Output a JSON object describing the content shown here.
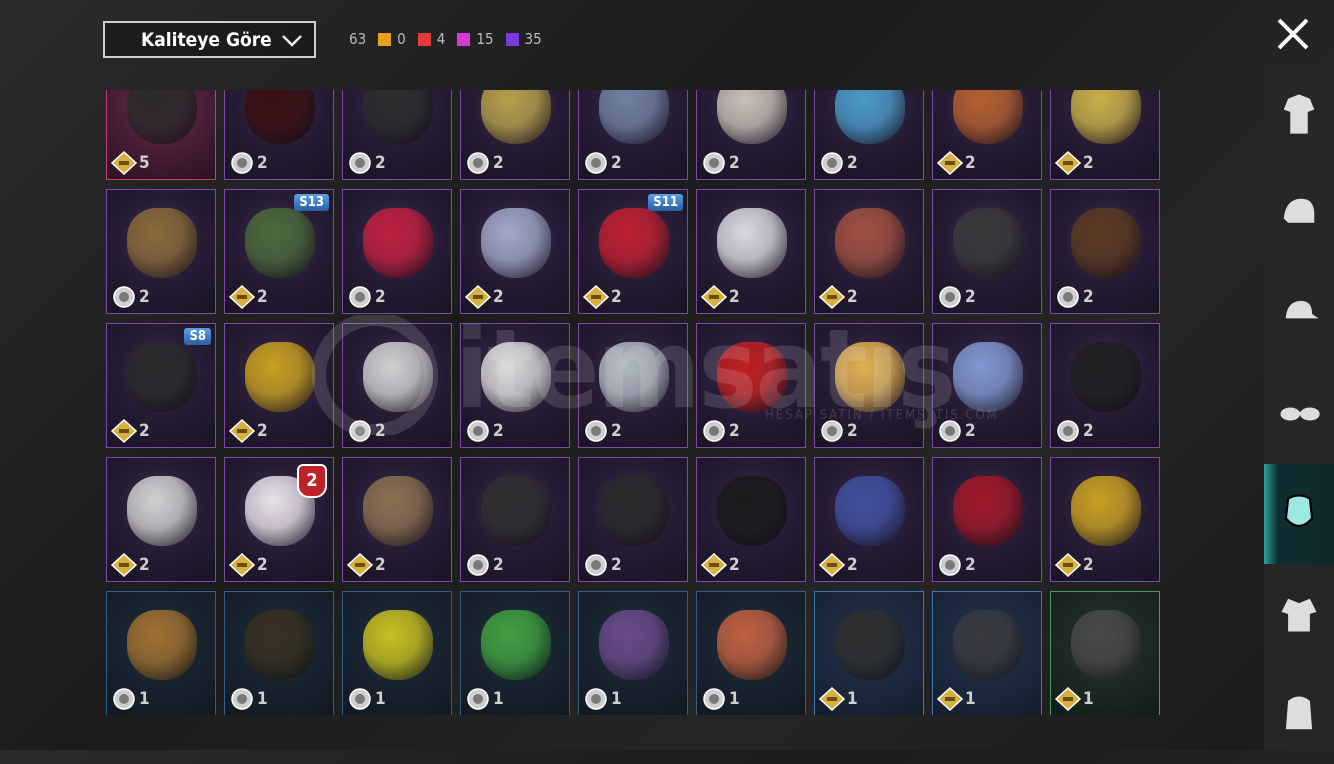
{
  "topbar": {
    "sort_label": "Kaliteye Göre",
    "total": "63",
    "counts": [
      {
        "color": "#e6a21e",
        "value": "0"
      },
      {
        "color": "#e23b3b",
        "value": "4"
      },
      {
        "color": "#d63ad6",
        "value": "15"
      },
      {
        "color": "#7a3ae0",
        "value": "35"
      }
    ]
  },
  "rows": [
    [
      {
        "tier": "pink",
        "art": "#2a2a2a",
        "qty": "5",
        "rank": true
      },
      {
        "tier": "purple",
        "art": "#3a1010",
        "qty": "2"
      },
      {
        "tier": "purple",
        "art": "#2c2c2c",
        "qty": "2"
      },
      {
        "tier": "purple",
        "art": "#b6a04a",
        "qty": "2"
      },
      {
        "tier": "purple",
        "art": "#7080a0",
        "qty": "2"
      },
      {
        "tier": "purple",
        "art": "#c8c0b6",
        "qty": "2"
      },
      {
        "tier": "purple",
        "art": "#4a9ac8",
        "qty": "2"
      },
      {
        "tier": "purple",
        "art": "#b56030",
        "qty": "2",
        "rank": true
      },
      {
        "tier": "purple",
        "art": "#c8b048",
        "qty": "2",
        "rank": true
      }
    ],
    [
      {
        "tier": "purple",
        "art": "#8a6a3a",
        "qty": "2"
      },
      {
        "tier": "purple",
        "art": "#4a6a3a",
        "qty": "2",
        "badge": "S13",
        "rank": true
      },
      {
        "tier": "purple",
        "art": "#c02040",
        "qty": "2"
      },
      {
        "tier": "purple",
        "art": "#a0a8c8",
        "qty": "2",
        "rank": true
      },
      {
        "tier": "purple",
        "art": "#c02030",
        "qty": "2",
        "badge": "S11",
        "rank": true
      },
      {
        "tier": "purple",
        "art": "#d8d8e0",
        "qty": "2",
        "rank": true
      },
      {
        "tier": "purple",
        "art": "#a05040",
        "qty": "2",
        "rank": true
      },
      {
        "tier": "purple",
        "art": "#3a3a3a",
        "qty": "2"
      },
      {
        "tier": "purple",
        "art": "#5a3a20",
        "qty": "2"
      }
    ],
    [
      {
        "tier": "purple",
        "art": "#2a2a2a",
        "qty": "2",
        "badge": "S8",
        "rank": true
      },
      {
        "tier": "purple",
        "art": "#c8a020",
        "qty": "2",
        "rank": true
      },
      {
        "tier": "purple",
        "art": "#d0d0d0",
        "qty": "2"
      },
      {
        "tier": "purple",
        "art": "#d8d8d8",
        "qty": "2"
      },
      {
        "tier": "purple",
        "art": "#b0b8c0",
        "qty": "2"
      },
      {
        "tier": "purple",
        "art": "#c02020",
        "qty": "2"
      },
      {
        "tier": "purple",
        "art": "#e0b050",
        "qty": "2"
      },
      {
        "tier": "purple",
        "art": "#8098d0",
        "qty": "2"
      },
      {
        "tier": "purple",
        "art": "#202020",
        "qty": "2"
      }
    ],
    [
      {
        "tier": "purple",
        "art": "#d0d0d0",
        "qty": "2",
        "rank": true
      },
      {
        "tier": "purple",
        "art": "#e8e0e8",
        "qty": "2",
        "count": "2",
        "rank": true
      },
      {
        "tier": "purple",
        "art": "#8a7050",
        "qty": "2",
        "rank": true
      },
      {
        "tier": "purple",
        "art": "#303030",
        "qty": "2"
      },
      {
        "tier": "purple",
        "art": "#2a2a2a",
        "qty": "2"
      },
      {
        "tier": "purple",
        "art": "#1a1a1a",
        "qty": "2",
        "rank": true
      },
      {
        "tier": "purple",
        "art": "#4050a0",
        "qty": "2",
        "rank": true
      },
      {
        "tier": "purple",
        "art": "#a01828",
        "qty": "2"
      },
      {
        "tier": "purple",
        "art": "#c8a020",
        "qty": "2",
        "rank": true
      }
    ],
    [
      {
        "tier": "blue",
        "art": "#a07030",
        "qty": "1"
      },
      {
        "tier": "blue",
        "art": "#3a3020",
        "qty": "1"
      },
      {
        "tier": "blue",
        "art": "#c8c020",
        "qty": "1"
      },
      {
        "tier": "blue",
        "art": "#40a040",
        "qty": "1"
      },
      {
        "tier": "blue",
        "art": "#6a4a8a",
        "qty": "1"
      },
      {
        "tier": "blue",
        "art": "#c06040",
        "qty": "1"
      },
      {
        "tier": "blue2",
        "art": "#303030",
        "qty": "1",
        "rank": true
      },
      {
        "tier": "blue2",
        "art": "#3a3a40",
        "qty": "1",
        "rank": true
      },
      {
        "tier": "green",
        "art": "#4a4a4a",
        "qty": "1",
        "rank": true
      }
    ]
  ],
  "sidebar": [
    {
      "name": "outfit-icon",
      "active": false
    },
    {
      "name": "helmet-icon",
      "active": false
    },
    {
      "name": "cap-icon",
      "active": false
    },
    {
      "name": "glasses-icon",
      "active": false
    },
    {
      "name": "mask-icon",
      "active": true
    },
    {
      "name": "jacket-icon",
      "active": false
    },
    {
      "name": "backpack-icon",
      "active": false
    }
  ],
  "watermark": {
    "text": "itemsatış",
    "sub": "HESAP SATIN / ITEMSATIŞ.COM"
  }
}
